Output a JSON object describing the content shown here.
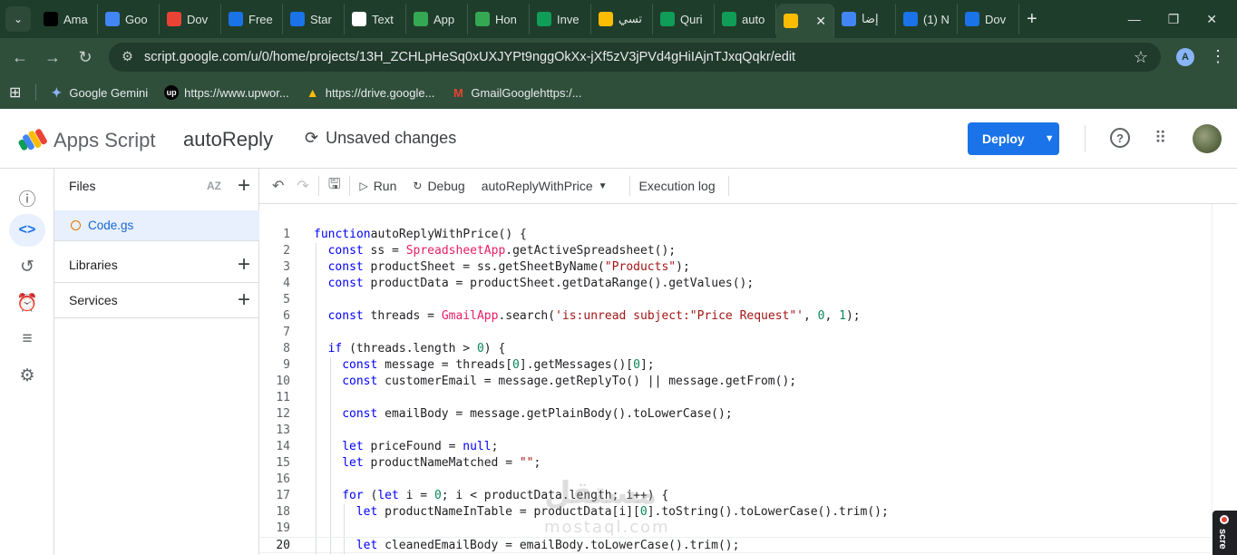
{
  "browser": {
    "tabs": [
      {
        "label": "Ama",
        "icon": "upwork-icon",
        "color": "#000000"
      },
      {
        "label": "Goo",
        "icon": "gemini-icon",
        "color": "#4285f4"
      },
      {
        "label": "Dov",
        "icon": "chrome-download-icon",
        "color": "#ea4335"
      },
      {
        "label": "Free",
        "icon": "gear-site-icon",
        "color": "#1a73e8"
      },
      {
        "label": "Star",
        "icon": "gear-site-icon",
        "color": "#1a73e8"
      },
      {
        "label": "Text",
        "icon": "text-site-icon",
        "color": "#ffffff"
      },
      {
        "label": "App",
        "icon": "drive-icon",
        "color": "#34a853"
      },
      {
        "label": "Hon",
        "icon": "drive-icon",
        "color": "#34a853"
      },
      {
        "label": "Inve",
        "icon": "sheets-icon",
        "color": "#0f9d58"
      },
      {
        "label": "تسي",
        "icon": "apps-script-icon",
        "color": "#fbbc04"
      },
      {
        "label": "Quri",
        "icon": "sheets-icon",
        "color": "#0f9d58"
      },
      {
        "label": "auto",
        "icon": "sheets-icon",
        "color": "#0f9d58"
      },
      {
        "label": "",
        "icon": "apps-script-icon",
        "color": "#fbbc04",
        "active": true
      },
      {
        "label": "إضا",
        "icon": "circle-site-icon",
        "color": "#4285f4"
      },
      {
        "label": "(1) N",
        "icon": "infinity-icon",
        "color": "#1a73e8"
      },
      {
        "label": "Dov",
        "icon": "infinity-icon",
        "color": "#1a73e8"
      }
    ],
    "url": "script.google.com/u/0/home/projects/13H_ZCHLpHeSq0xUXJYPt9nggOkXx-jXf5zV3jPVd4gHiIAjnTJxqQqkr/edit",
    "profile_initial": "A",
    "bookmarks": [
      {
        "label": "Google Gemini",
        "icon": "gemini-icon"
      },
      {
        "label": "https://www.upwor...",
        "icon": "upwork-icon"
      },
      {
        "label": "https://drive.google...",
        "icon": "drive-icon"
      },
      {
        "label": "GmailGooglehttps:/...",
        "icon": "gmail-icon"
      }
    ]
  },
  "app": {
    "product": "Apps Script",
    "project": "autoReply",
    "status": "Unsaved changes",
    "deploy_label": "Deploy",
    "accent": "#1a73e8"
  },
  "files_panel": {
    "files_label": "Files",
    "sort_label": "AZ",
    "file_name": "Code.gs",
    "libraries_label": "Libraries",
    "services_label": "Services"
  },
  "toolbar": {
    "run_label": "Run",
    "debug_label": "Debug",
    "function_name": "autoReplyWithPrice",
    "log_label": "Execution log"
  },
  "watermark": {
    "arabic": "مستقل",
    "latin": "mostaql.com"
  },
  "recorder_label": "scre",
  "code_lines": [
    {
      "n": "1",
      "indent": 0,
      "tokens": [
        [
          "kw",
          "function"
        ],
        [
          "",
          "autoReplyWithPrice() {"
        ]
      ]
    },
    {
      "n": "2",
      "indent": 1,
      "tokens": [
        [
          "kw",
          "const"
        ],
        [
          "",
          " ss = "
        ],
        [
          "cls",
          "SpreadsheetApp"
        ],
        [
          "",
          ".getActiveSpreadsheet();"
        ]
      ]
    },
    {
      "n": "3",
      "indent": 1,
      "tokens": [
        [
          "kw",
          "const"
        ],
        [
          "",
          " productSheet = ss.getSheetByName("
        ],
        [
          "str",
          "\"Products\""
        ],
        [
          "",
          ");"
        ]
      ]
    },
    {
      "n": "4",
      "indent": 1,
      "tokens": [
        [
          "kw",
          "const"
        ],
        [
          "",
          " productData = productSheet.getDataRange().getValues();"
        ]
      ]
    },
    {
      "n": "5",
      "indent": 1,
      "tokens": []
    },
    {
      "n": "6",
      "indent": 1,
      "tokens": [
        [
          "kw",
          "const"
        ],
        [
          "",
          " threads = "
        ],
        [
          "cls",
          "GmailApp"
        ],
        [
          "",
          ".search("
        ],
        [
          "str",
          "'is:unread subject:\"Price Request\"'"
        ],
        [
          "",
          ", "
        ],
        [
          "num",
          "0"
        ],
        [
          "",
          ", "
        ],
        [
          "num",
          "1"
        ],
        [
          "",
          ");"
        ]
      ]
    },
    {
      "n": "7",
      "indent": 1,
      "tokens": []
    },
    {
      "n": "8",
      "indent": 1,
      "tokens": [
        [
          "kw",
          "if"
        ],
        [
          "",
          " (threads.length > "
        ],
        [
          "num",
          "0"
        ],
        [
          "",
          ") {"
        ]
      ]
    },
    {
      "n": "9",
      "indent": 2,
      "tokens": [
        [
          "kw",
          "const"
        ],
        [
          "",
          " message = threads["
        ],
        [
          "num",
          "0"
        ],
        [
          "",
          "].getMessages()["
        ],
        [
          "num",
          "0"
        ],
        [
          "",
          "];"
        ]
      ]
    },
    {
      "n": "10",
      "indent": 2,
      "tokens": [
        [
          "kw",
          "const"
        ],
        [
          "",
          " customerEmail = message.getReplyTo() || message.getFrom();"
        ]
      ]
    },
    {
      "n": "11",
      "indent": 2,
      "tokens": []
    },
    {
      "n": "12",
      "indent": 2,
      "tokens": [
        [
          "kw",
          "const"
        ],
        [
          "",
          " emailBody = message.getPlainBody().toLowerCase();"
        ]
      ]
    },
    {
      "n": "13",
      "indent": 2,
      "tokens": []
    },
    {
      "n": "14",
      "indent": 2,
      "tokens": [
        [
          "kw",
          "let"
        ],
        [
          "",
          " priceFound = "
        ],
        [
          "kw",
          "null"
        ],
        [
          "",
          ";"
        ]
      ]
    },
    {
      "n": "15",
      "indent": 2,
      "tokens": [
        [
          "kw",
          "let"
        ],
        [
          "",
          " productNameMatched = "
        ],
        [
          "str",
          "\"\""
        ],
        [
          "",
          ";"
        ]
      ]
    },
    {
      "n": "16",
      "indent": 2,
      "tokens": []
    },
    {
      "n": "17",
      "indent": 2,
      "tokens": [
        [
          "kw",
          "for"
        ],
        [
          "",
          " ("
        ],
        [
          "kw",
          "let"
        ],
        [
          "",
          " i = "
        ],
        [
          "num",
          "0"
        ],
        [
          "",
          "; i < productData.length; i++) {"
        ]
      ]
    },
    {
      "n": "18",
      "indent": 3,
      "tokens": [
        [
          "kw",
          "let"
        ],
        [
          "",
          " productNameInTable = productData[i]["
        ],
        [
          "num",
          "0"
        ],
        [
          "",
          "].toString().toLowerCase().trim();"
        ]
      ]
    },
    {
      "n": "19",
      "indent": 3,
      "tokens": []
    },
    {
      "n": "20",
      "indent": 3,
      "current": true,
      "tokens": [
        [
          "kw",
          "let"
        ],
        [
          "",
          " cleanedEmailBody = emailBody.toLowerCase().trim();"
        ]
      ]
    }
  ]
}
